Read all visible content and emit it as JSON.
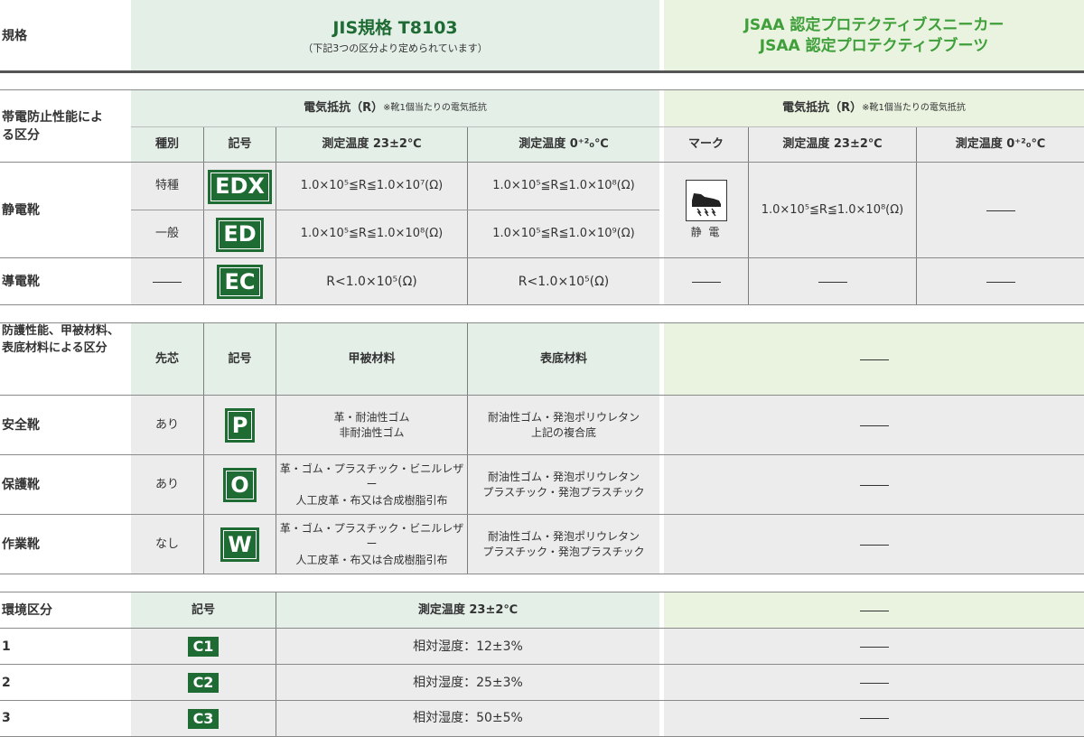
{
  "header": {
    "left_label": "規格",
    "jis_title": "JIS規格 T8103",
    "jis_sub": "（下記3つの区分より定められています）",
    "jsaa_line1": "JSAA 認定プロテクティブスニーカー",
    "jsaa_line2": "JSAA 認定プロテクティブブーツ"
  },
  "section1": {
    "label": "帯電防止性能による区分",
    "jis_group": "電気抵抗（R）",
    "jis_note": "※靴1個当たりの電気抵抗",
    "jsaa_group": "電気抵抗（R）",
    "jsaa_note": "※靴1個当たりの電気抵抗",
    "col_type": "種別",
    "col_code": "記号",
    "col_t23": "測定温度 23±2℃",
    "col_t0": "測定温度 0⁺²₀℃",
    "col_mark": "マーク",
    "col_jsaa_t23": "測定温度 23±2℃",
    "col_jsaa_t0": "測定温度 0⁺²₀℃",
    "static_label": "静電靴",
    "rows": [
      {
        "type": "特種",
        "code": "EDX",
        "t23": "1.0×10⁵≦R≦1.0×10⁷(Ω)",
        "t0": "1.0×10⁵≦R≦1.0×10⁸(Ω)"
      },
      {
        "type": "一般",
        "code": "ED",
        "t23": "1.0×10⁵≦R≦1.0×10⁸(Ω)",
        "t0": "1.0×10⁵≦R≦1.0×10⁹(Ω)"
      }
    ],
    "jsaa_static_mark_text": "静 電",
    "jsaa_static_t23": "1.0×10⁵≦R≦1.0×10⁸(Ω)",
    "conductive": {
      "label": "導電靴",
      "code": "EC",
      "t23": "R<1.0×10⁵(Ω)",
      "t0": "R<1.0×10⁵(Ω)"
    }
  },
  "section2": {
    "label_line1": "防護性能、甲被材料、",
    "label_line2": "表底材料による区分",
    "col_toe": "先芯",
    "col_code": "記号",
    "col_upper": "甲被材料",
    "col_sole": "表底材料",
    "rows": [
      {
        "label": "安全靴",
        "toe": "あり",
        "code": "P",
        "upper1": "革・耐油性ゴム",
        "upper2": "非耐油性ゴム",
        "sole1": "耐油性ゴム・発泡ポリウレタン",
        "sole2": "上記の複合底"
      },
      {
        "label": "保護靴",
        "toe": "あり",
        "code": "O",
        "upper1": "革・ゴム・プラスチック・ビニルレザー",
        "upper2": "人工皮革・布又は合成樹脂引布",
        "sole1": "耐油性ゴム・発泡ポリウレタン",
        "sole2": "プラスチック・発泡プラスチック"
      },
      {
        "label": "作業靴",
        "toe": "なし",
        "code": "W",
        "upper1": "革・ゴム・プラスチック・ビニルレザー",
        "upper2": "人工皮革・布又は合成樹脂引布",
        "sole1": "耐油性ゴム・発泡ポリウレタン",
        "sole2": "プラスチック・発泡プラスチック"
      }
    ]
  },
  "section3": {
    "label": "環境区分",
    "col_code": "記号",
    "col_temp": "測定温度 23±2℃",
    "rows": [
      {
        "label": "1",
        "code": "C1",
        "humidity": "相対湿度：12±3%"
      },
      {
        "label": "2",
        "code": "C2",
        "humidity": "相対湿度：25±3%"
      },
      {
        "label": "3",
        "code": "C3",
        "humidity": "相対湿度：50±5%"
      }
    ]
  },
  "colors": {
    "jis_green": "#1e6b34",
    "jsaa_green": "#3f9f3a",
    "jis_bg": "#e4efe8",
    "jsaa_bg": "#e9f3df",
    "cell_gray": "#ececec"
  }
}
